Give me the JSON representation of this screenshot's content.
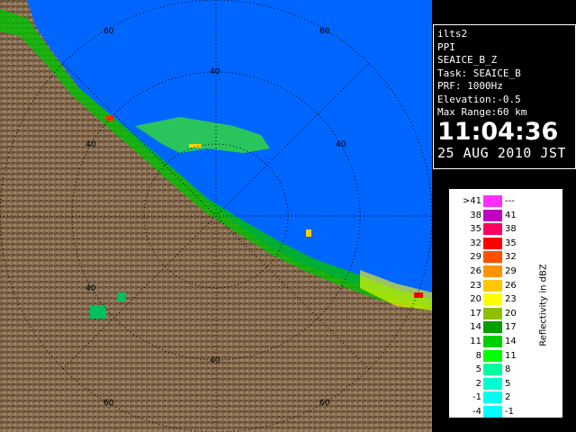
{
  "info": {
    "station": "ilts2",
    "product": "PPI",
    "product_name": "SEAICE_B_Z",
    "task": "Task: SEAICE_B",
    "prf": "PRF: 1000Hz",
    "elevation": "Elevation:-0.5",
    "max_range": "Max Range:60 km",
    "time": "11:04:36",
    "date": "25 AUG 2010 JST"
  },
  "range_labels": [
    "60",
    "60",
    "40",
    "40",
    "40",
    "40",
    "40",
    "60",
    "60"
  ],
  "legend": {
    "title": "Reflectivity in dBZ",
    "rows": [
      {
        "left": ">41",
        "right": "---",
        "color": "#ff2fff"
      },
      {
        "left": "38",
        "right": "41",
        "color": "#bf00bf"
      },
      {
        "left": "35",
        "right": "38",
        "color": "#ff0060"
      },
      {
        "left": "32",
        "right": "35",
        "color": "#ff0000"
      },
      {
        "left": "29",
        "right": "32",
        "color": "#ff5000"
      },
      {
        "left": "26",
        "right": "29",
        "color": "#ff9400"
      },
      {
        "left": "23",
        "right": "26",
        "color": "#ffc800"
      },
      {
        "left": "20",
        "right": "23",
        "color": "#ffff00"
      },
      {
        "left": "17",
        "right": "20",
        "color": "#8fbf00"
      },
      {
        "left": "14",
        "right": "17",
        "color": "#00a000"
      },
      {
        "left": "11",
        "right": "14",
        "color": "#00d000"
      },
      {
        "left": "8",
        "right": "11",
        "color": "#00ff00"
      },
      {
        "left": "5",
        "right": "8",
        "color": "#00ff9f"
      },
      {
        "left": "2",
        "right": "5",
        "color": "#00ffcf"
      },
      {
        "left": "-1",
        "right": "2",
        "color": "#00ffef"
      },
      {
        "left": "-4",
        "right": "-1",
        "color": "#00ffff"
      }
    ]
  }
}
